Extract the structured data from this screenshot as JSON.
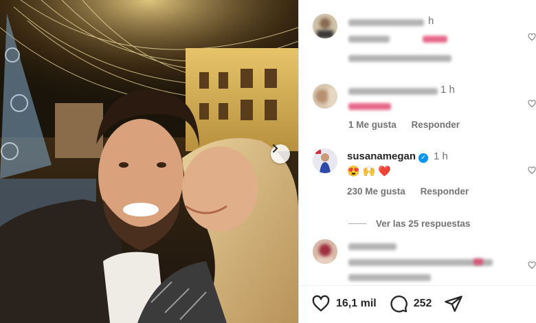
{
  "photo": {
    "carousel_next_icon": "chevron-right-icon"
  },
  "comments": [
    {
      "username": "",
      "time": "h",
      "likes_label": "",
      "reply_label": ""
    },
    {
      "username": "",
      "time": "1 h",
      "likes_label": "1 Me gusta",
      "reply_label": "Responder"
    },
    {
      "username": "susanamegan",
      "verified": true,
      "time": "1 h",
      "emojis": "😍🙌❤️",
      "likes_label": "230 Me gusta",
      "reply_label": "Responder",
      "view_replies_label": "Ver las 25 respuestas"
    },
    {
      "username": "",
      "time": ""
    }
  ],
  "actions": {
    "likes_count": "16,1 mil",
    "comments_count": "252",
    "like_icon": "heart-icon",
    "comment_icon": "comment-icon",
    "share_icon": "send-icon"
  },
  "colors": {
    "verified": "#0095f6",
    "text": "#262626",
    "secondary": "#737373"
  }
}
